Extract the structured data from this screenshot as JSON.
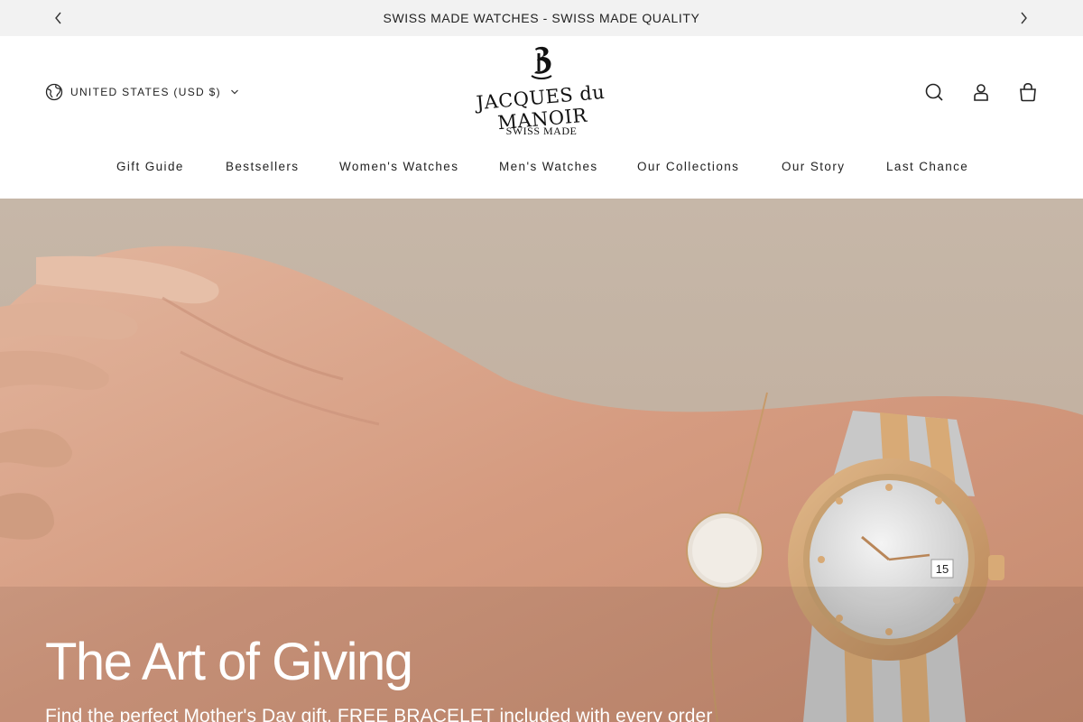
{
  "announcement": {
    "message": "SWISS MADE WATCHES - SWISS MADE QUALITY",
    "prev_icon": "chevron-left-icon",
    "next_icon": "chevron-right-icon"
  },
  "header": {
    "country_selector": {
      "label": "UNITED STATES (USD $)",
      "icon": "globe-icon"
    },
    "logo": {
      "monogram": "B",
      "brand": "JACQUES du MANOIR",
      "subtitle": "SWISS MADE"
    },
    "icons": [
      "search-icon",
      "account-icon",
      "shopping-bag-icon"
    ]
  },
  "nav": {
    "items": [
      {
        "label": "Gift Guide"
      },
      {
        "label": "Bestsellers"
      },
      {
        "label": "Women's Watches"
      },
      {
        "label": "Men's Watches"
      },
      {
        "label": "Our Collections"
      },
      {
        "label": "Our Story"
      },
      {
        "label": "Last Chance"
      }
    ]
  },
  "hero": {
    "title": "The Art of Giving",
    "subtitle": "Find the perfect Mother's Day gift. FREE BRACELET included with every order",
    "watch_dial_date": "15",
    "colors": {
      "background": "#c4b4a4",
      "skin": "#d9a489",
      "gold": "#c79a6a",
      "silver": "#c8c8c8"
    }
  }
}
